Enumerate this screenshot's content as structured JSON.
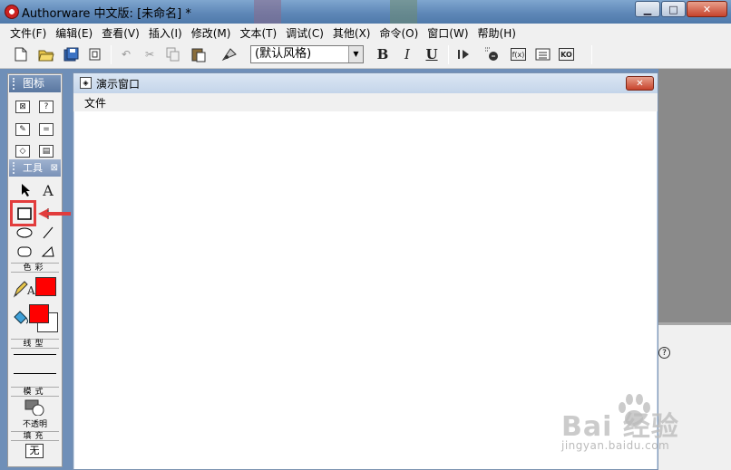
{
  "window": {
    "title": "Authorware 中文版: [未命名] *",
    "minimize_glyph": "▁",
    "maximize_glyph": "□",
    "close_glyph": "✕"
  },
  "menubar": {
    "items": [
      "文件(F)",
      "编辑(E)",
      "查看(V)",
      "插入(I)",
      "修改(M)",
      "文本(T)",
      "调试(C)",
      "其他(X)",
      "命令(O)",
      "窗口(W)",
      "帮助(H)"
    ]
  },
  "toolbar": {
    "style_select_value": "(默认风格)",
    "bold_label": "B",
    "italic_label": "I",
    "underline_label": "U",
    "fn_label": "f(x)",
    "ko_label": "KO"
  },
  "palette": {
    "icons_title": "图标",
    "tools_title": "工具",
    "text_tool_label": "A",
    "color_label": "色彩",
    "text_color_label": "A",
    "line_label": "线型",
    "mode_label": "模式",
    "mode_value": "不透明",
    "fill_label": "填充",
    "fill_value": "无",
    "stroke_color": "#ff0000",
    "fill_foreground_color": "#ff0000",
    "fill_background_color": "#ffffff",
    "highlight_color": "#e23c3c"
  },
  "presentation": {
    "title": "演示窗口",
    "menu_file": "文件"
  },
  "help": {
    "glyph": "?"
  },
  "watermark": {
    "brand": "Bai  经验",
    "url": "jingyan.baidu.com"
  }
}
